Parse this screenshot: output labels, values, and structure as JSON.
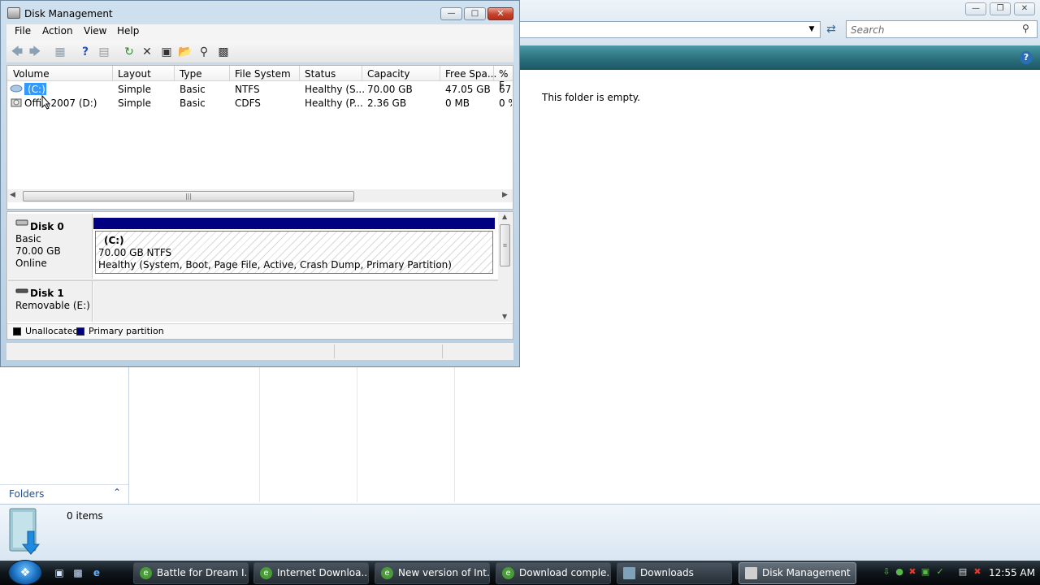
{
  "explorer": {
    "search_placeholder": "Search",
    "empty_message": "This folder is empty.",
    "folders_label": "Folders",
    "items_count": "0 items"
  },
  "disk_management": {
    "title": "Disk Management",
    "menu": [
      "File",
      "Action",
      "View",
      "Help"
    ],
    "columns": [
      "Volume",
      "Layout",
      "Type",
      "File System",
      "Status",
      "Capacity",
      "Free Spa...",
      "% F"
    ],
    "volumes": [
      {
        "volume": "(C:)",
        "layout": "Simple",
        "type": "Basic",
        "fs": "NTFS",
        "status": "Healthy (S...",
        "capacity": "70.00 GB",
        "free": "47.05 GB",
        "pct": "67"
      },
      {
        "volume": "Offi...2007 (D:)",
        "layout": "Simple",
        "type": "Basic",
        "fs": "CDFS",
        "status": "Healthy (P...",
        "capacity": "2.36 GB",
        "free": "0 MB",
        "pct": "0 %"
      }
    ],
    "disk0": {
      "name": "Disk 0",
      "type": "Basic",
      "size": "70.00 GB",
      "state": "Online"
    },
    "partition": {
      "label": "(C:)",
      "size": "70.00 GB NTFS",
      "status": "Healthy (System, Boot, Page File, Active, Crash Dump, Primary Partition)"
    },
    "disk1": {
      "name": "Disk 1",
      "desc": "Removable (E:)"
    },
    "legend": {
      "unallocated": "Unallocated",
      "primary": "Primary partition"
    },
    "colors": {
      "primary": "#000080",
      "unallocated": "#000000",
      "selection": "#3399ff"
    }
  },
  "taskbar": {
    "buttons": [
      "Battle for Dream I...",
      "Internet Downloa...",
      "New version of Int...",
      "Download comple...",
      "Downloads",
      "Disk Management"
    ],
    "clock": "12:55 AM"
  }
}
